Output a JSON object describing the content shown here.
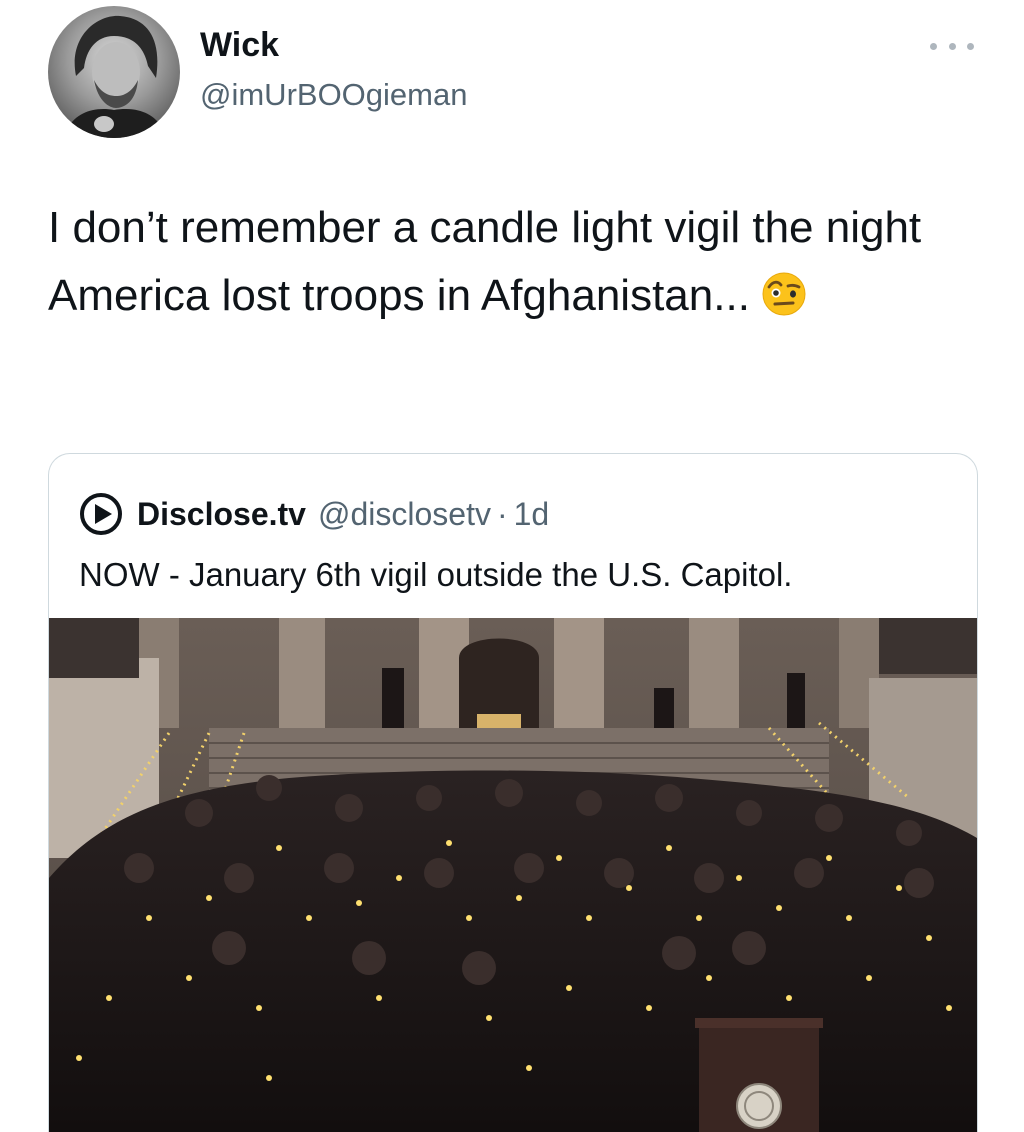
{
  "author": {
    "display_name": "Wick",
    "handle": "@imUrBOOgieman",
    "avatar_icon": "profile-photo"
  },
  "tweet": {
    "text": "I don’t remember a candle light vigil the night America lost troops in Afghanistan...",
    "emoji": "face-with-raised-eyebrow"
  },
  "more_icon": "ellipsis-icon",
  "quoted_tweet": {
    "logo_icon": "play-circle-logo",
    "display_name": "Disclose.tv",
    "handle": "@disclosetv",
    "separator": "·",
    "time": "1d",
    "text": "NOW - January 6th vigil outside the U.S. Capitol.",
    "media": "photo of candle light vigil on the U.S. Capitol steps at night"
  },
  "colors": {
    "text_primary": "#0f1419",
    "text_secondary": "#536471",
    "border": "#cfd9de"
  }
}
